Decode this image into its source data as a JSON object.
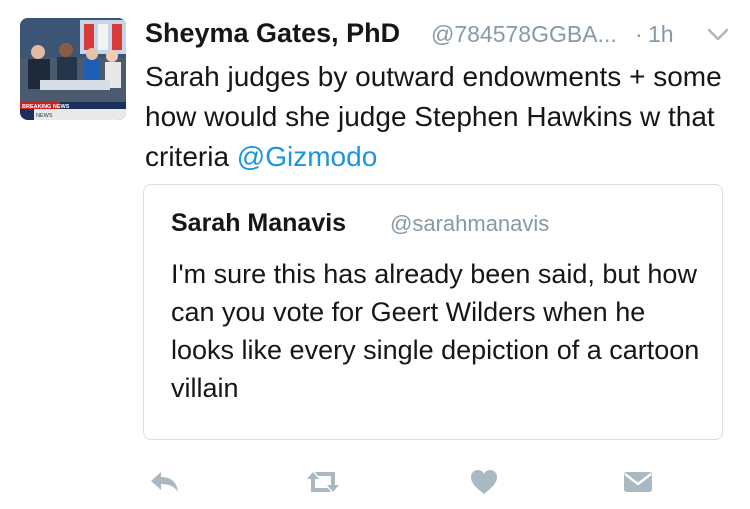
{
  "tweet": {
    "author_name": "Sheyma Gates, PhD",
    "author_handle": "@784578GGBA...",
    "separator": "·",
    "time": "1h",
    "text_before_mention": "Sarah judges by outward endowments + some how would she judge Stephen Hawkins w that criteria ",
    "mention": "@Gizmodo"
  },
  "avatar_image": {
    "banner_text": "BREAKING NEWS",
    "ticker_text": "NEWS"
  },
  "quoted_tweet": {
    "author_name": "Sarah Manavis",
    "author_handle": "@sarahmanavis",
    "text": "I'm sure this has already been said, but how can you vote for Geert Wilders when he looks like every single depiction of a cartoon villain"
  },
  "actions": {
    "icons": [
      "reply-icon",
      "retweet-icon",
      "like-icon",
      "direct-message-icon"
    ]
  },
  "colors": {
    "text": "#14171a",
    "muted": "#8899a6",
    "link": "#1b95e0",
    "action_icon": "#aab8c2",
    "border": "#d8dee4"
  }
}
